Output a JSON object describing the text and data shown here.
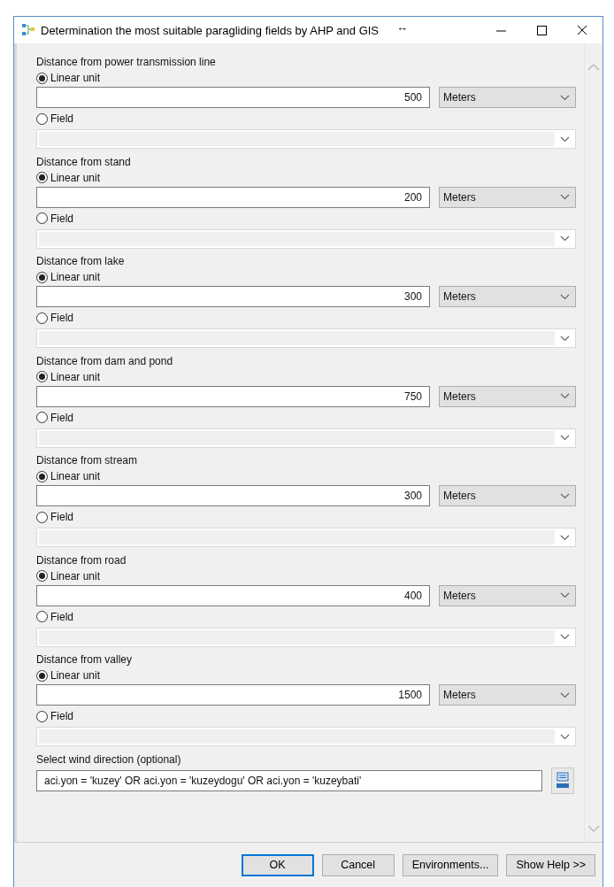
{
  "window": {
    "title": "Determination the most suitable paragliding fields by AHP and GIS",
    "resize_glyph": "↔"
  },
  "parameters": [
    {
      "label": "Distance from power transmission line",
      "linear_unit": {
        "label": "Linear unit",
        "selected": true
      },
      "value": "500",
      "unit": "Meters",
      "field": {
        "label": "Field",
        "selected": false
      }
    },
    {
      "label": "Distance from stand",
      "linear_unit": {
        "label": "Linear unit",
        "selected": true
      },
      "value": "200",
      "unit": "Meters",
      "field": {
        "label": "Field",
        "selected": false
      }
    },
    {
      "label": "Distance from lake",
      "linear_unit": {
        "label": "Linear unit",
        "selected": true
      },
      "value": "300",
      "unit": "Meters",
      "field": {
        "label": "Field",
        "selected": false
      }
    },
    {
      "label": "Distance from dam and pond",
      "linear_unit": {
        "label": "Linear unit",
        "selected": true
      },
      "value": "750",
      "unit": "Meters",
      "field": {
        "label": "Field",
        "selected": false
      }
    },
    {
      "label": "Distance from stream",
      "linear_unit": {
        "label": "Linear unit",
        "selected": true
      },
      "value": "300",
      "unit": "Meters",
      "field": {
        "label": "Field",
        "selected": false
      }
    },
    {
      "label": "Distance from road",
      "linear_unit": {
        "label": "Linear unit",
        "selected": true
      },
      "value": "400",
      "unit": "Meters",
      "field": {
        "label": "Field",
        "selected": false
      }
    },
    {
      "label": "Distance from valley",
      "linear_unit": {
        "label": "Linear unit",
        "selected": true
      },
      "value": "1500",
      "unit": "Meters",
      "field": {
        "label": "Field",
        "selected": false
      }
    }
  ],
  "wind": {
    "label": "Select wind direction (optional)",
    "value": "aci.yon = 'kuzey' OR aci.yon = 'kuzeydogu' OR aci.yon = 'kuzeybati'"
  },
  "buttons": [
    {
      "label": "OK",
      "kind": "default"
    },
    {
      "label": "Cancel",
      "kind": "normal"
    },
    {
      "label": "Environments...",
      "kind": "normal"
    },
    {
      "label": "Show Help >>",
      "kind": "normal"
    }
  ]
}
